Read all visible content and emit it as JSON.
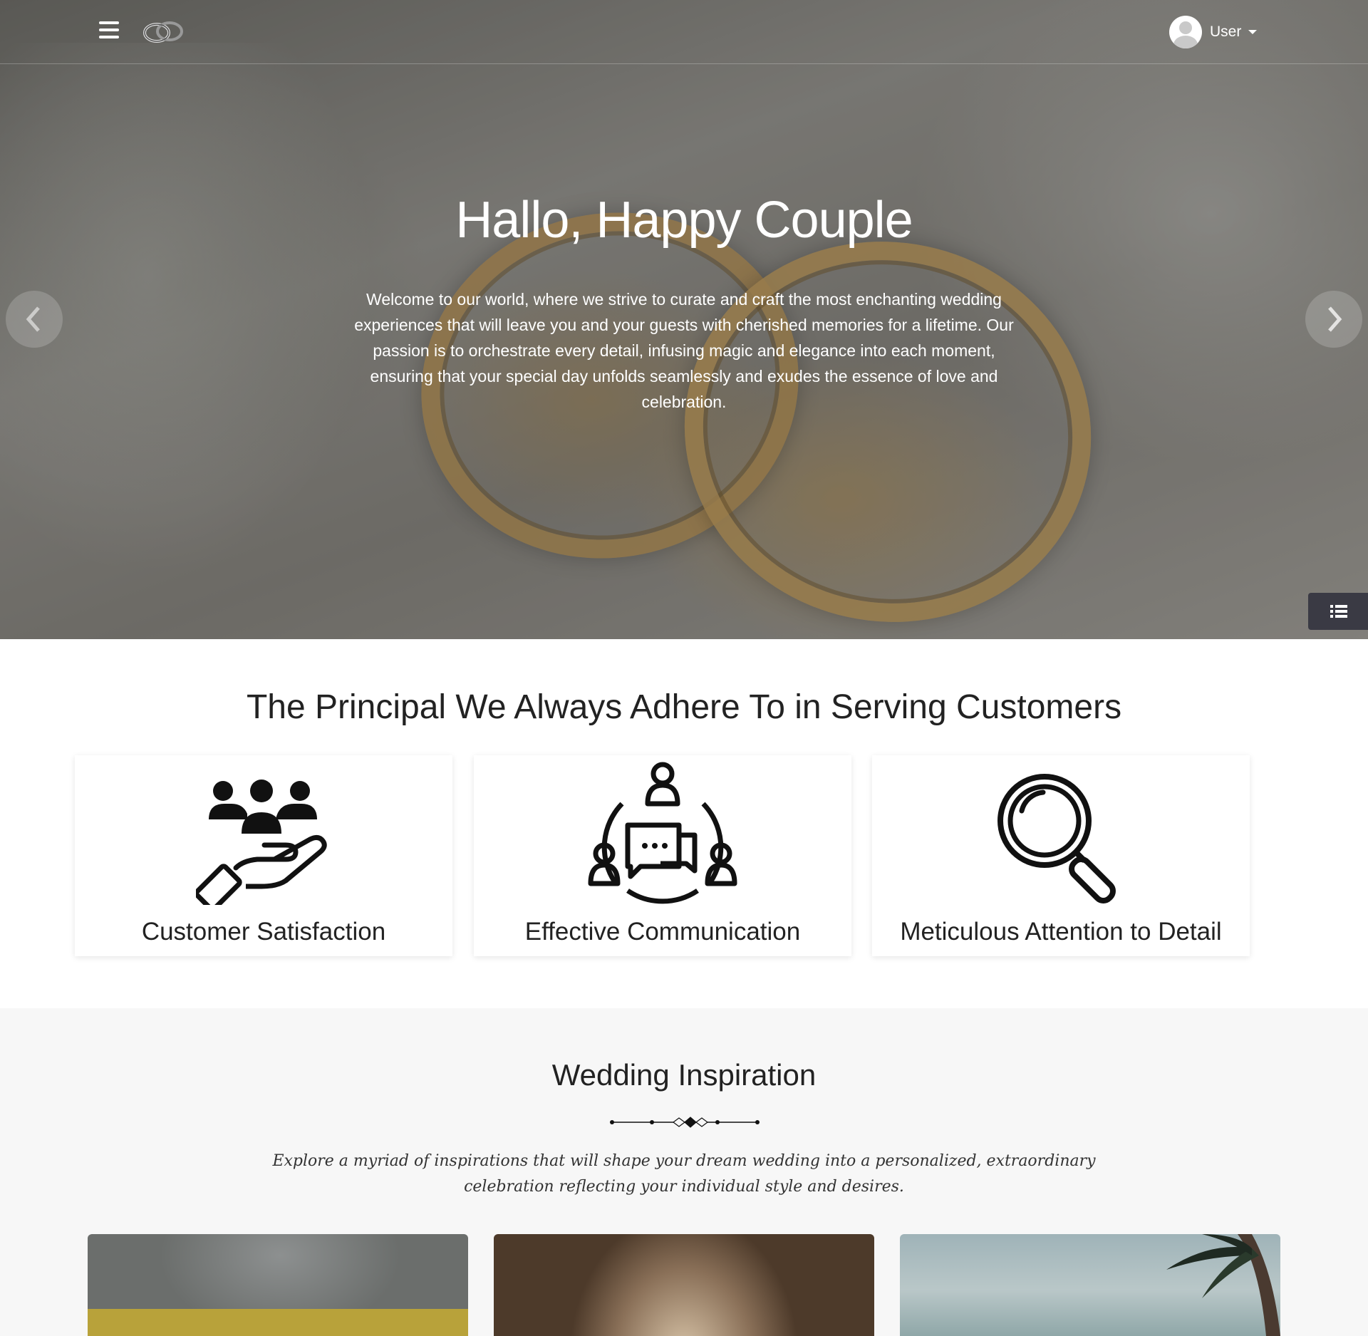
{
  "header": {
    "menu_icon": "hamburger-icon",
    "logo_icon": "wedding-rings-logo",
    "user_label": "User"
  },
  "hero": {
    "title": "Hallo, Happy Couple",
    "text": "Welcome to our world, where we strive to curate and craft the most enchanting wedding experiences that will leave you and your guests with cherished memories for a lifetime. Our passion is to orchestrate every detail, infusing magic and elegance into each moment, ensuring that your special day unfolds seamlessly and exudes the essence of love and celebration.",
    "prev_icon": "chevron-left-icon",
    "next_icon": "chevron-right-icon",
    "list_icon": "list-icon"
  },
  "principles": {
    "title": "The Principal We Always Adhere To in Serving Customers",
    "cards": [
      {
        "label": "Customer Satisfaction",
        "icon": "hand-people-icon"
      },
      {
        "label": "Effective Communication",
        "icon": "communication-icon"
      },
      {
        "label": "Meticulous Attention to Detail",
        "icon": "magnifier-icon"
      }
    ]
  },
  "inspiration": {
    "title": "Wedding Inspiration",
    "text": "Explore a myriad of inspirations that will shape your dream wedding into a personalized, extraordinary celebration reflecting your individual style and desires."
  },
  "colors": {
    "hero_text": "#ffffff",
    "list_toggle_bg": "#3a3a44",
    "inspiration_bg": "#f7f7f7",
    "heading": "#222222"
  }
}
